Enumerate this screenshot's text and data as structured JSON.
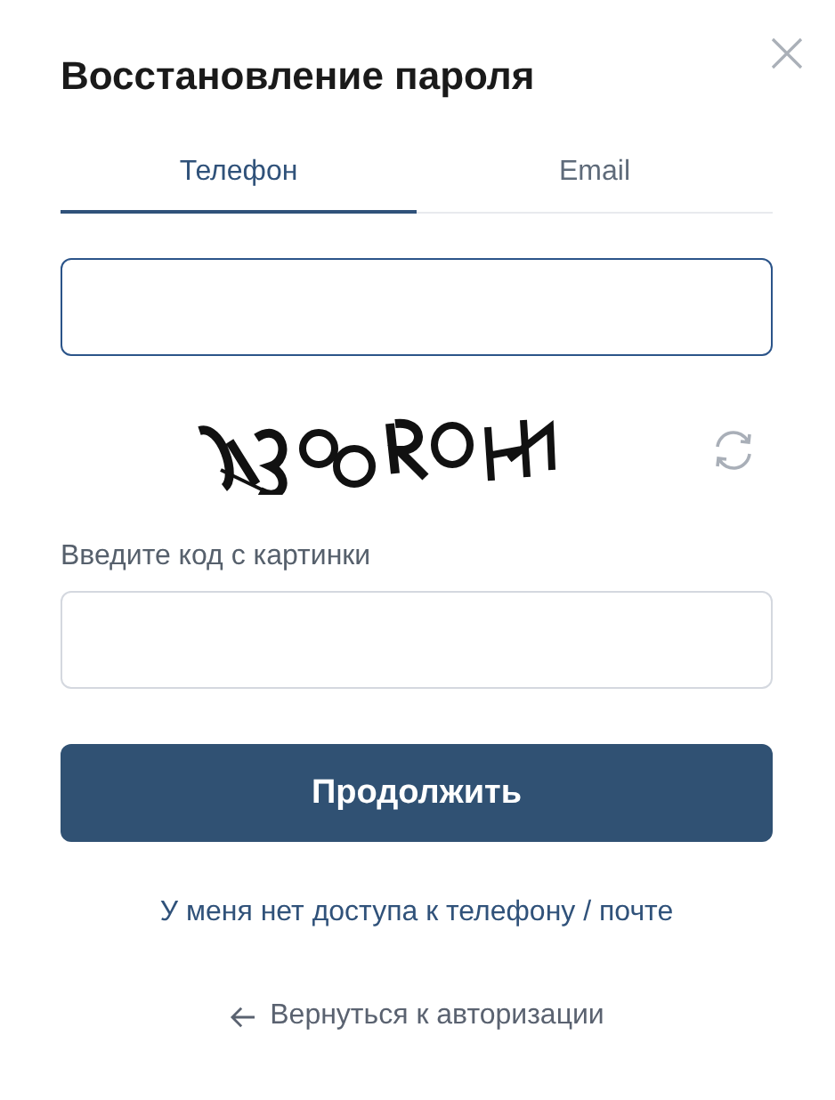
{
  "title": "Восстановление пароля",
  "tabs": [
    {
      "label": "Телефон",
      "selected": true
    },
    {
      "label": "Email",
      "selected": false
    }
  ],
  "code_label": "Введите код с картинки",
  "submit": "Продолжить",
  "no_access_link": "У меня нет доступа к телефону / почте",
  "back_link": "Вернуться к авторизации"
}
